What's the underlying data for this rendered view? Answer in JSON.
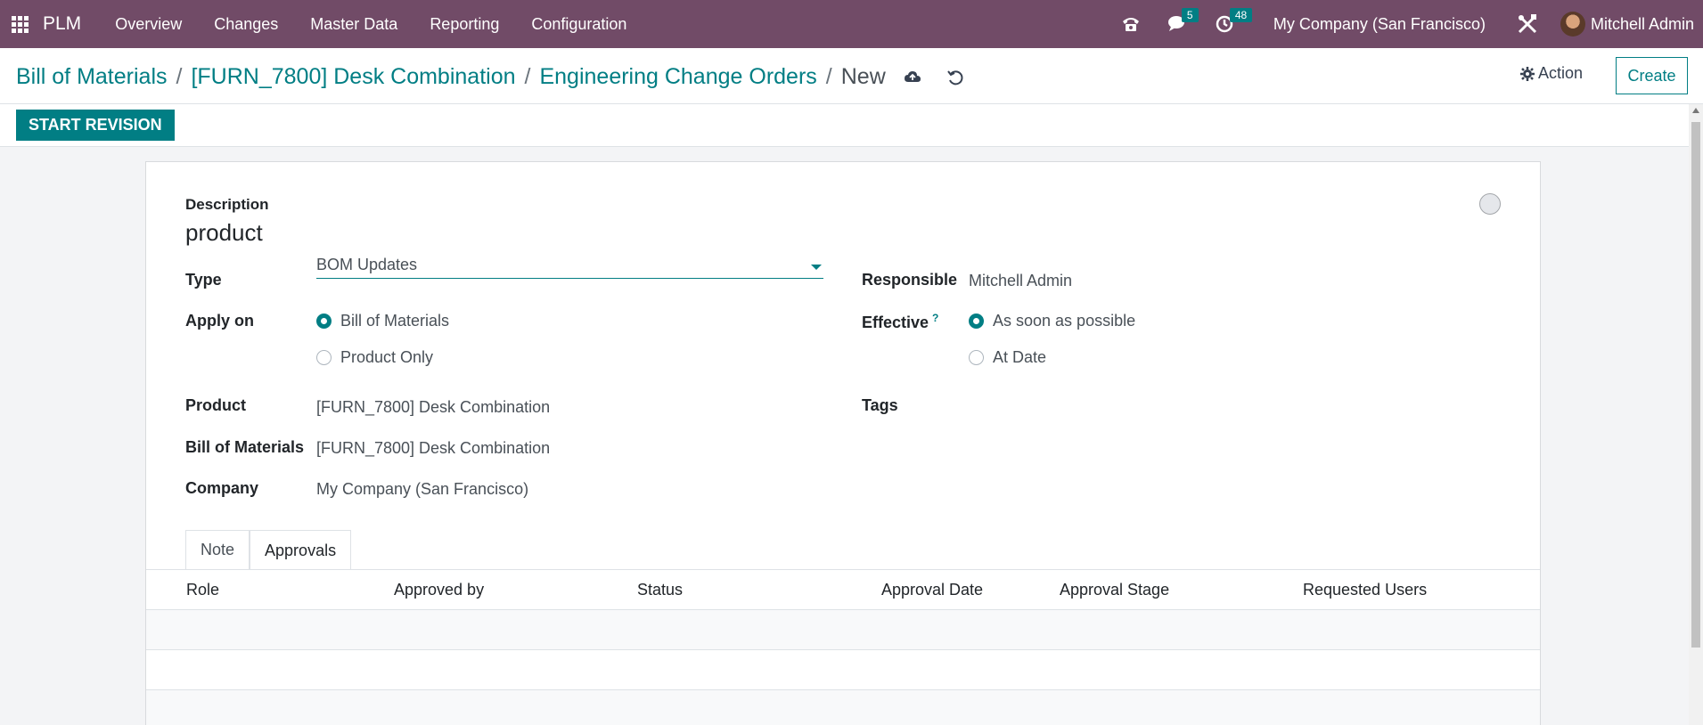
{
  "topbar": {
    "brand": "PLM",
    "menu": [
      "Overview",
      "Changes",
      "Master Data",
      "Reporting",
      "Configuration"
    ],
    "messages_count": "5",
    "activities_count": "48",
    "company": "My Company (San Francisco)",
    "user": "Mitchell Admin"
  },
  "breadcrumb": {
    "items": [
      "Bill of Materials",
      "[FURN_7800] Desk Combination",
      "Engineering Change Orders"
    ],
    "current": "New"
  },
  "control": {
    "action_label": "Action",
    "create_label": "Create"
  },
  "statusbar": {
    "start_revision_label": "START REVISION"
  },
  "form": {
    "description_label": "Description",
    "description_value": "product",
    "type_label": "Type",
    "type_value": "BOM Updates",
    "apply_on_label": "Apply on",
    "apply_on_options": [
      "Bill of Materials",
      "Product Only"
    ],
    "apply_on_selected": "Bill of Materials",
    "product_label": "Product",
    "product_value": "[FURN_7800] Desk Combination",
    "bom_label": "Bill of Materials",
    "bom_value": "[FURN_7800] Desk Combination",
    "company_label": "Company",
    "company_value": "My Company (San Francisco)",
    "responsible_label": "Responsible",
    "responsible_value": "Mitchell Admin",
    "effective_label": "Effective",
    "effective_help": "?",
    "effective_options": [
      "As soon as possible",
      "At Date"
    ],
    "effective_selected": "As soon as possible",
    "tags_label": "Tags"
  },
  "tabs": {
    "items": [
      "Note",
      "Approvals"
    ],
    "active": "Approvals"
  },
  "approvals_table": {
    "columns": [
      "Role",
      "Approved by",
      "Status",
      "Approval Date",
      "Approval Stage",
      "Requested Users"
    ],
    "rows": []
  },
  "colors": {
    "topbar_bg": "#714b67",
    "accent": "#017e84"
  }
}
